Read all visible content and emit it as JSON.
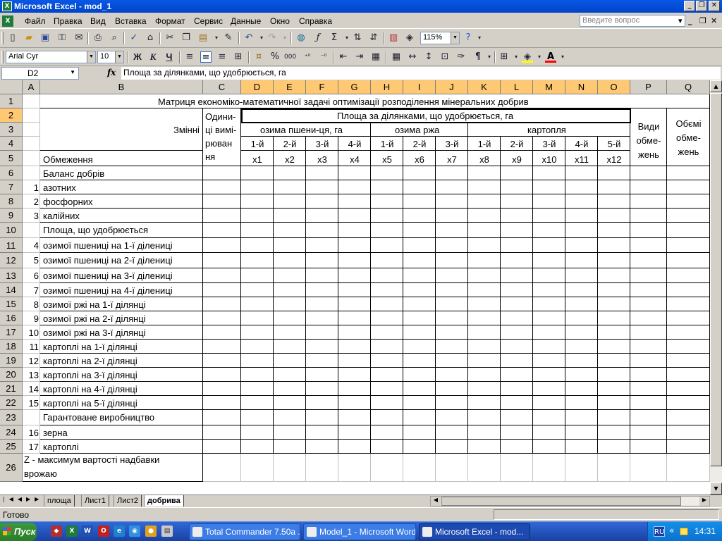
{
  "window": {
    "title": "Microsoft Excel - mod_1"
  },
  "menu": {
    "items": [
      "Файл",
      "Правка",
      "Вид",
      "Вставка",
      "Формат",
      "Сервис",
      "Данные",
      "Окно",
      "Справка"
    ],
    "ask_placeholder": "Введите вопрос"
  },
  "toolbar": {
    "zoom": "115%",
    "font_name": "Arial Cyr",
    "font_size": "10",
    "bold": "Ж",
    "italic": "К",
    "underline": "Ч",
    "percent": "%",
    "thousands": "000"
  },
  "formula_bar": {
    "name_box": "D2",
    "fx": "fx",
    "formula": "Площа за ділянками, що удобрюється, га"
  },
  "columns": [
    "A",
    "B",
    "C",
    "D",
    "E",
    "F",
    "G",
    "H",
    "I",
    "J",
    "K",
    "L",
    "M",
    "N",
    "O",
    "P",
    "Q"
  ],
  "rows": [
    "1",
    "2",
    "3",
    "4",
    "5",
    "6",
    "7",
    "8",
    "9",
    "10",
    "11",
    "12",
    "13",
    "14",
    "15",
    "16",
    "17",
    "18",
    "19",
    "20",
    "21",
    "22",
    "23",
    "24",
    "25",
    "26"
  ],
  "sheet": {
    "title": "Матриця економіко-математичної задачі оптимізації розподілення мінеральних добрив",
    "header_vars": "Змінні",
    "header_constraints": "Обмеження",
    "header_units": [
      "Одини-",
      "ці вимі-",
      "рюван",
      "ня"
    ],
    "header_area": "Площа за ділянками, що удобрюється, га",
    "header_wheat": "озима пшени-ця, га",
    "header_rye": "озима ржа",
    "header_potato": "картопля",
    "plots": [
      "1-й",
      "2-й",
      "3-й",
      "4-й",
      "1-й",
      "2-й",
      "3-й",
      "1-й",
      "2-й",
      "3-й",
      "4-й",
      "5-й"
    ],
    "vars": [
      "x1",
      "x2",
      "x3",
      "x4",
      "x5",
      "x6",
      "x7",
      "x8",
      "x9",
      "x10",
      "x11",
      "x12"
    ],
    "header_types": [
      "Види",
      "обме-",
      "жень"
    ],
    "header_volumes": [
      "Обємі",
      "обме-",
      "жень"
    ],
    "body": [
      {
        "num": "",
        "label": "Баланс добрів"
      },
      {
        "num": "1",
        "label": "азотних"
      },
      {
        "num": "2",
        "label": "фосфорних"
      },
      {
        "num": "3",
        "label": "калійних"
      },
      {
        "num": "",
        "label": "Площа, що удобрюється"
      },
      {
        "num": "4",
        "label": "озимої пшениці на 1-ї ділениці"
      },
      {
        "num": "5",
        "label": "озимої пшениці на 2-ї ділениці"
      },
      {
        "num": "6",
        "label": "озимої пшениці на 3-ї ділениці"
      },
      {
        "num": "7",
        "label": "озимої пшениці на 4-ї ділениці"
      },
      {
        "num": "8",
        "label": "озимої ржі на 1-ї ділянці"
      },
      {
        "num": "9",
        "label": "озимої ржі на 2-ї ділянці"
      },
      {
        "num": "10",
        "label": "озимої ржі на 3-ї ділянці"
      },
      {
        "num": "11",
        "label": "картоплі на 1-ї ділянці"
      },
      {
        "num": "12",
        "label": "картоплі на 2-ї ділянці"
      },
      {
        "num": "13",
        "label": "картоплі на 3-ї ділянці"
      },
      {
        "num": "14",
        "label": "картоплі на 4-ї ділянці"
      },
      {
        "num": "15",
        "label": "картоплі на 5-ї ділянці"
      },
      {
        "num": "",
        "label": "Гарантоване виробництво"
      },
      {
        "num": "16",
        "label": "зерна"
      },
      {
        "num": "17",
        "label": "картоплі"
      }
    ],
    "objective": [
      "Z - максимум вартості надбавки",
      "врожаю"
    ]
  },
  "tabs": {
    "items": [
      "площа",
      "Лист1",
      "Лист2",
      "добрива"
    ],
    "active": "добрива"
  },
  "status": {
    "text": "Готово"
  },
  "taskbar": {
    "start": "Пуск",
    "tasks": [
      "Total Commander 7.50a ...",
      "Model_1 - Microsoft Word",
      "Microsoft Excel - mod..."
    ],
    "lang": "RU",
    "clock": "14:31"
  }
}
